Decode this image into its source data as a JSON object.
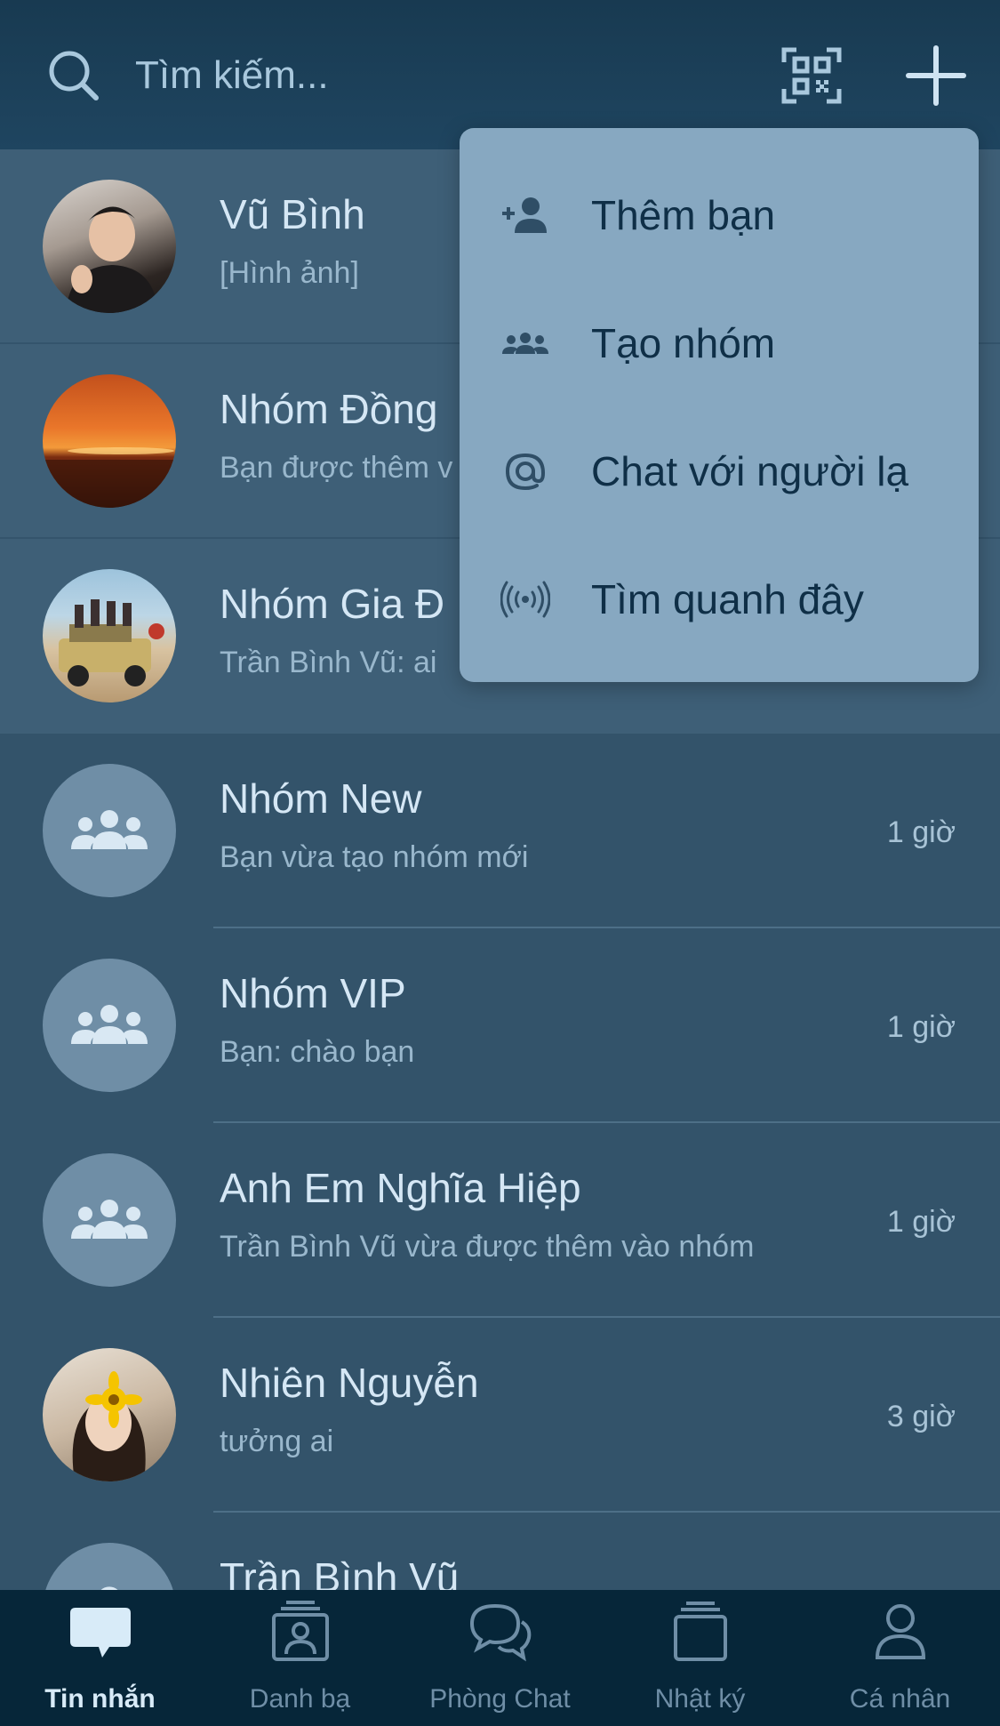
{
  "search": {
    "placeholder": "Tìm kiếm...",
    "icon": "search-icon"
  },
  "header_actions": {
    "qr_icon": "qr-code-icon",
    "add_icon": "plus-icon"
  },
  "menu": {
    "items": [
      {
        "label": "Thêm bạn",
        "icon": "add-friend-icon"
      },
      {
        "label": "Tạo nhóm",
        "icon": "group-icon"
      },
      {
        "label": "Chat với người lạ",
        "icon": "at-sign-icon"
      },
      {
        "label": "Tìm quanh đây",
        "icon": "nearby-broadcast-icon"
      }
    ]
  },
  "chats": [
    {
      "name": "Vũ Bình",
      "preview": "[Hình ảnh]",
      "time": "",
      "avatar": "photo"
    },
    {
      "name": "Nhóm Đồng",
      "preview": "Bạn được thêm v",
      "time": "",
      "avatar": "photo"
    },
    {
      "name": "Nhóm Gia Đ",
      "preview": "Trần Bình Vũ: ai",
      "time": "",
      "avatar": "photo"
    },
    {
      "name": "Nhóm New",
      "preview": "Bạn vừa tạo nhóm mới",
      "time": "1 giờ",
      "avatar": "group"
    },
    {
      "name": "Nhóm VIP",
      "preview": "Bạn: chào bạn",
      "time": "1 giờ",
      "avatar": "group"
    },
    {
      "name": "Anh Em Nghĩa Hiệp",
      "preview": "Trần Bình Vũ vừa được thêm vào nhóm",
      "time": "1 giờ",
      "avatar": "group"
    },
    {
      "name": "Nhiên Nguyễn",
      "preview": "tưởng ai",
      "time": "3 giờ",
      "avatar": "photo"
    },
    {
      "name": "Trần Bình Vũ",
      "preview": "",
      "time": "",
      "avatar": "person"
    }
  ],
  "bottom_nav": {
    "items": [
      {
        "label": "Tin nhắn",
        "icon": "chat-bubble-icon",
        "active": true
      },
      {
        "label": "Danh bạ",
        "icon": "contacts-icon",
        "active": false
      },
      {
        "label": "Phòng Chat",
        "icon": "chat-room-icon",
        "active": false
      },
      {
        "label": "Nhật ký",
        "icon": "journal-icon",
        "active": false
      },
      {
        "label": "Cá nhân",
        "icon": "profile-icon",
        "active": false
      }
    ]
  },
  "colors": {
    "header": "#1c405a",
    "list_background": "#33536a",
    "menu_background": "#87a8c1",
    "nav_background": "#062639",
    "active_tab": "#d8ebf8"
  }
}
